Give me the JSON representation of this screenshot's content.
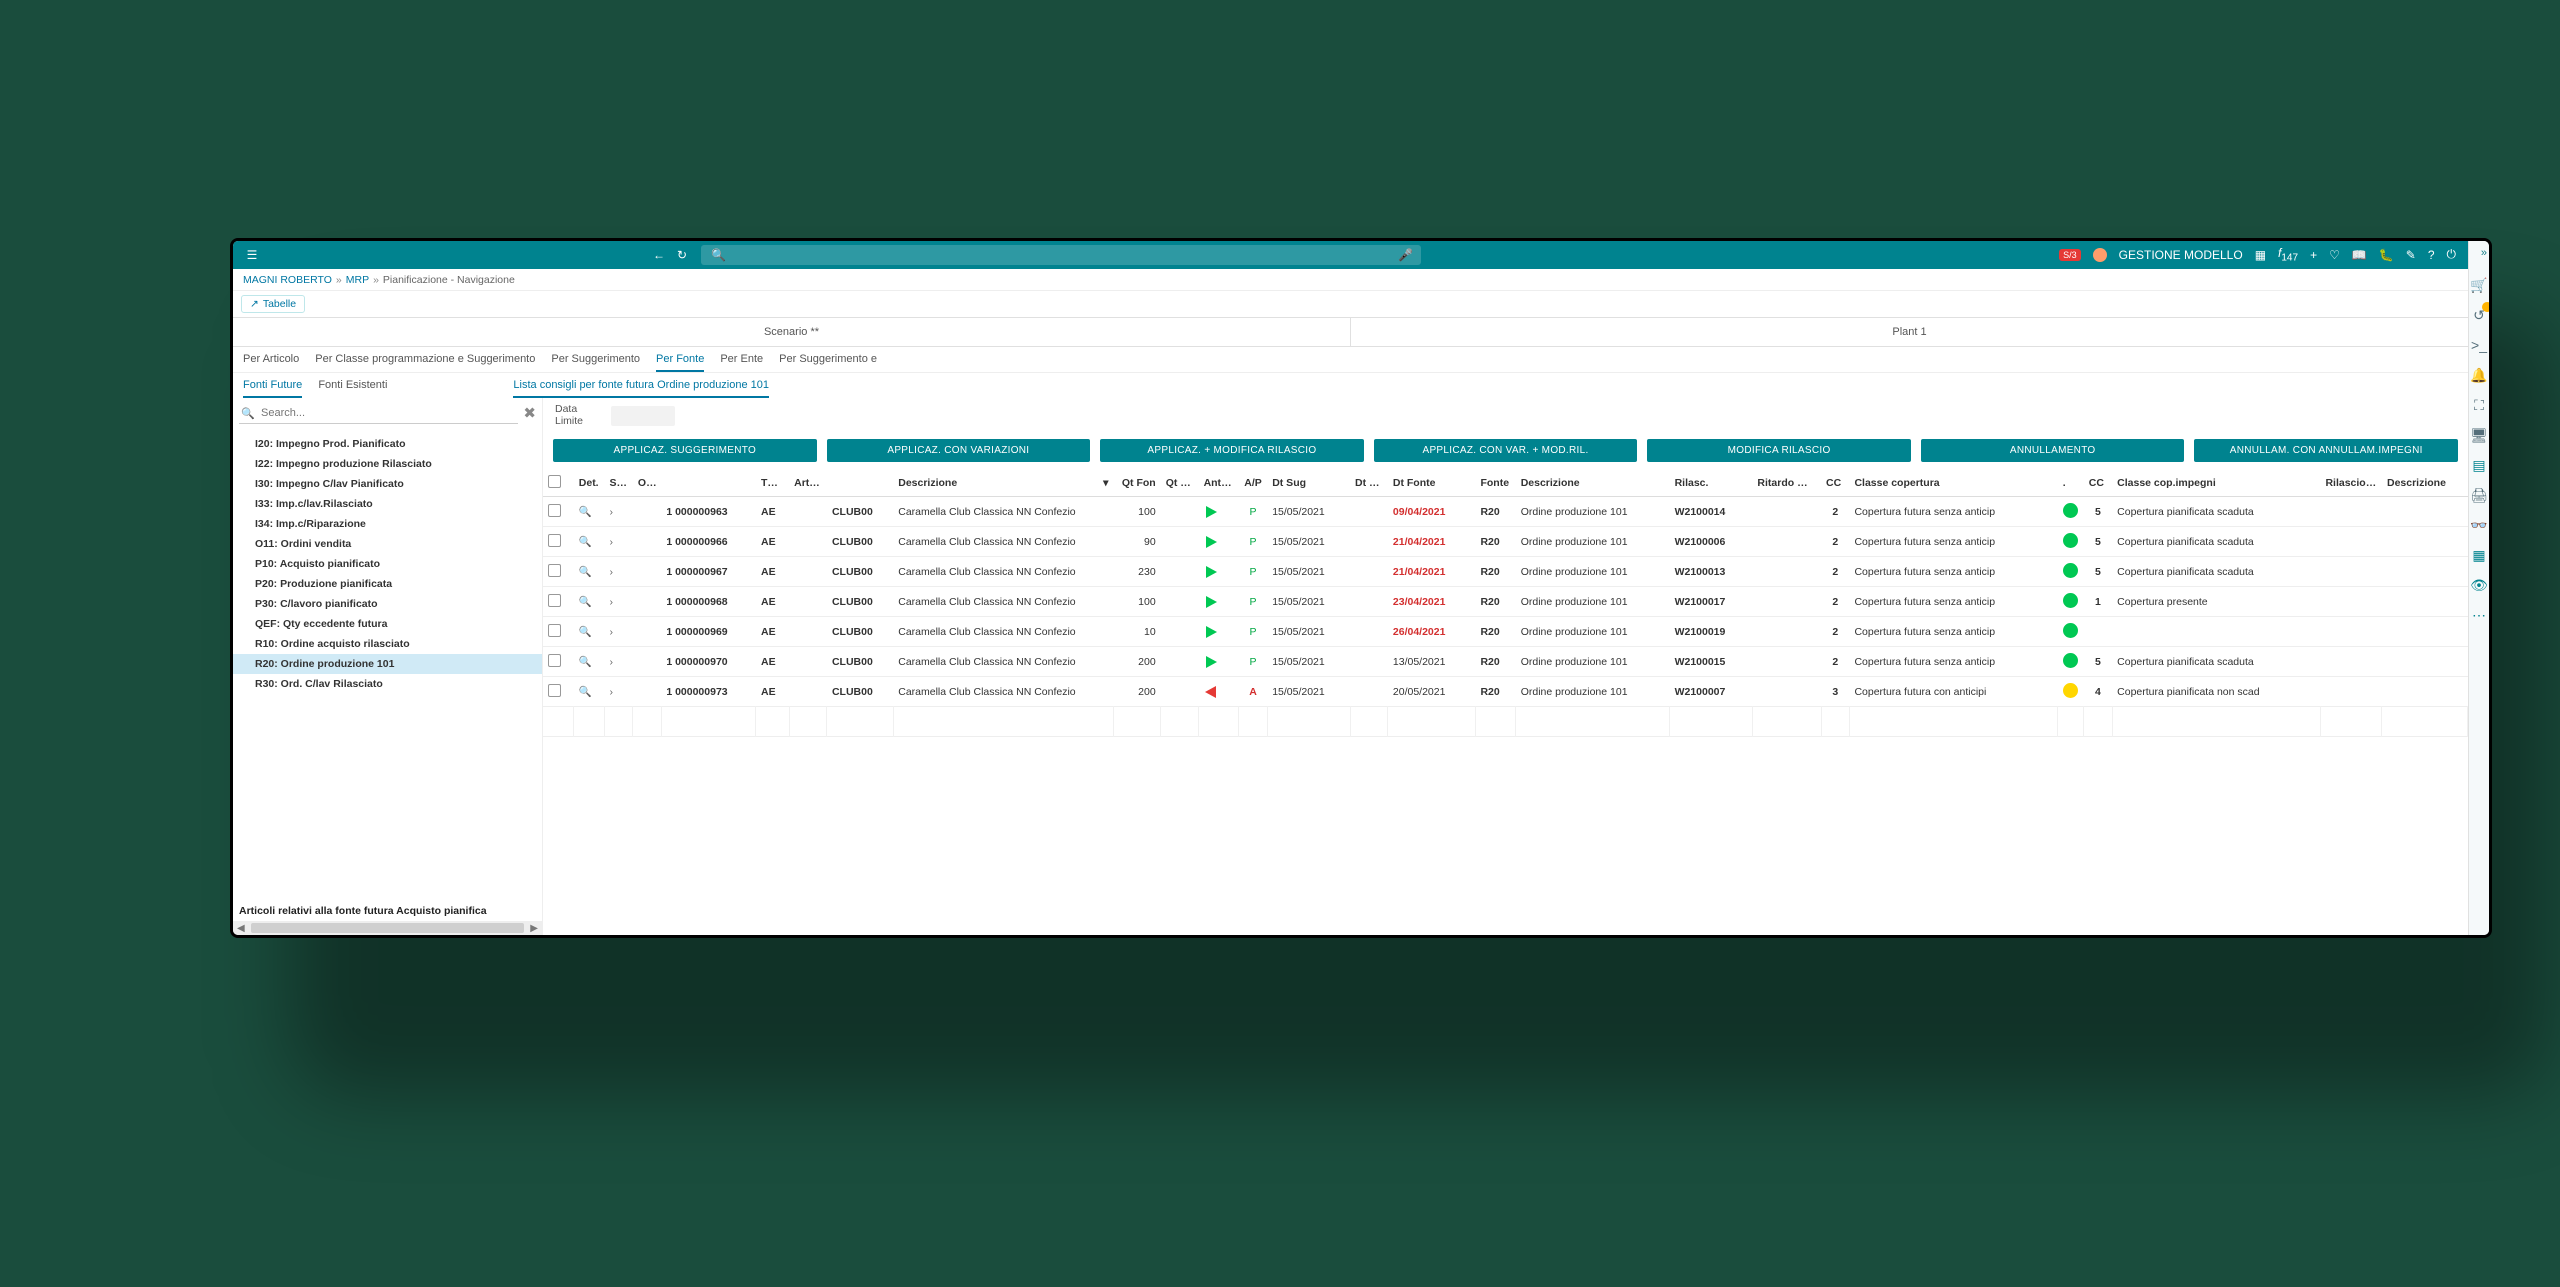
{
  "topbar": {
    "search_placeholder": "",
    "brand_badge": "S/3",
    "user_label": "GESTIONE MODELLO",
    "fx_label": "f",
    "fx_count": "147"
  },
  "breadcrumb": [
    "MAGNI ROBERTO",
    "MRP",
    "Pianificazione - Navigazione"
  ],
  "chip_label": "Tabelle",
  "header": {
    "scenario": "Scenario **",
    "plant": "Plant 1"
  },
  "tabs": [
    "Per Articolo",
    "Per Classe programmazione e Suggerimento",
    "Per Suggerimento",
    "Per Fonte",
    "Per Ente",
    "Per Suggerimento e"
  ],
  "subtabs": [
    "Fonti Future",
    "Fonti Esistenti"
  ],
  "subtabs_detail": "Lista consigli per fonte futura Ordine produzione 101",
  "sidebar": {
    "search_placeholder": "Search...",
    "items": [
      "I20: Impegno Prod. Pianificato",
      "I22: Impegno produzione Rilasciato",
      "I30: Impegno C/lav Pianificato",
      "I33: Imp.c/lav.Rilasciato",
      "I34: Imp.c/Riparazione",
      "O11: Ordini vendita",
      "P10: Acquisto pianificato",
      "P20: Produzione pianificata",
      "P30: C/lavoro pianificato",
      "QEF: Qty eccedente futura",
      "R10: Ordine acquisto rilasciato",
      "R20: Ordine produzione 101",
      "R30: Ord. C/lav Rilasciato"
    ],
    "footer_msg": "Articoli relativi alla fonte futura Acquisto pianifica"
  },
  "content": {
    "data_limite_label": "Data Limite",
    "buttons": [
      "APPLICAZ. SUGGERIMENTO",
      "APPLICAZ. CON VARIAZIONI",
      "APPLICAZ. + MODIFICA RILASCIO",
      "APPLICAZ. CON VAR. + MOD.RIL.",
      "MODIFICA RILASCIO",
      "ANNULLAMENTO",
      "ANNULLAM. CON ANNULLAM.IMPEGNI"
    ]
  },
  "right_rail": {
    "badge": ""
  },
  "table": {
    "headers": {
      "det": "Det.",
      "sug": "Sug.",
      "origine": "Origine",
      "tp_sug": "Tp Sug",
      "articolo": "Articolo",
      "descrizione": "Descrizione",
      "qt_fon": "Qt Fon",
      "qt_sug": "Qt Sug",
      "ant_rit": "Ant. Rit.",
      "ap": "A/P",
      "dt_sug": "Dt Sug",
      "dt_fp": "Dt F.p.",
      "dt_fonte": "Dt Fonte",
      "fonte": "Fonte",
      "descrizione2": "Descrizione",
      "rilasc": "Rilasc.",
      "rit_min": "Ritardo Minimo presunto Lordo",
      "cc": "CC",
      "classe_cop": "Classe copertura",
      "dot": ".",
      "cc2": "CC",
      "classe_cop_imp": "Classe cop.impegni",
      "ril_selfie": "Rilascio Selfie",
      "descrizione3": "Descrizione"
    },
    "rows": [
      {
        "origine": "1 000000963",
        "ae": "AE",
        "art": "CLUB00",
        "desc": "Caramella Club Classica NN Confezio",
        "qt_fon": "100",
        "ap": "P",
        "dt_sug": "15/05/2021",
        "dt_fonte": "09/04/2021",
        "dt_fonte_red": true,
        "fonte": "R20",
        "desc2": "Ordine produzione 101",
        "rilasc": "W2100014",
        "cc": "2",
        "classe_cop": "Copertura futura senza anticip",
        "status": "green",
        "cc2": "5",
        "classe_imp": "Copertura pianificata scaduta"
      },
      {
        "origine": "1 000000966",
        "ae": "AE",
        "art": "CLUB00",
        "desc": "Caramella Club Classica NN Confezio",
        "qt_fon": "90",
        "ap": "P",
        "dt_sug": "15/05/2021",
        "dt_fonte": "21/04/2021",
        "dt_fonte_red": true,
        "fonte": "R20",
        "desc2": "Ordine produzione 101",
        "rilasc": "W2100006",
        "cc": "2",
        "classe_cop": "Copertura futura senza anticip",
        "status": "green",
        "cc2": "5",
        "classe_imp": "Copertura pianificata scaduta"
      },
      {
        "origine": "1 000000967",
        "ae": "AE",
        "art": "CLUB00",
        "desc": "Caramella Club Classica NN Confezio",
        "qt_fon": "230",
        "ap": "P",
        "dt_sug": "15/05/2021",
        "dt_fonte": "21/04/2021",
        "dt_fonte_red": true,
        "fonte": "R20",
        "desc2": "Ordine produzione 101",
        "rilasc": "W2100013",
        "cc": "2",
        "classe_cop": "Copertura futura senza anticip",
        "status": "green",
        "cc2": "5",
        "classe_imp": "Copertura pianificata scaduta"
      },
      {
        "origine": "1 000000968",
        "ae": "AE",
        "art": "CLUB00",
        "desc": "Caramella Club Classica NN Confezio",
        "qt_fon": "100",
        "ap": "P",
        "dt_sug": "15/05/2021",
        "dt_fonte": "23/04/2021",
        "dt_fonte_red": true,
        "fonte": "R20",
        "desc2": "Ordine produzione 101",
        "rilasc": "W2100017",
        "cc": "2",
        "classe_cop": "Copertura futura senza anticip",
        "status": "green",
        "cc2": "1",
        "classe_imp": "Copertura presente"
      },
      {
        "origine": "1 000000969",
        "ae": "AE",
        "art": "CLUB00",
        "desc": "Caramella Club Classica NN Confezio",
        "qt_fon": "10",
        "ap": "P",
        "dt_sug": "15/05/2021",
        "dt_fonte": "26/04/2021",
        "dt_fonte_red": true,
        "fonte": "R20",
        "desc2": "Ordine produzione 101",
        "rilasc": "W2100019",
        "cc": "2",
        "classe_cop": "Copertura futura senza anticip",
        "status": "green",
        "cc2": "",
        "classe_imp": ""
      },
      {
        "origine": "1 000000970",
        "ae": "AE",
        "art": "CLUB00",
        "desc": "Caramella Club Classica NN Confezio",
        "qt_fon": "200",
        "ap": "P",
        "dt_sug": "15/05/2021",
        "dt_fonte": "13/05/2021",
        "dt_fonte_red": false,
        "fonte": "R20",
        "desc2": "Ordine produzione 101",
        "rilasc": "W2100015",
        "cc": "2",
        "classe_cop": "Copertura futura senza anticip",
        "status": "green",
        "cc2": "5",
        "classe_imp": "Copertura pianificata scaduta"
      },
      {
        "origine": "1 000000973",
        "ae": "AE",
        "art": "CLUB00",
        "desc": "Caramella Club Classica NN Confezio",
        "qt_fon": "200",
        "ap": "A",
        "ap_red": true,
        "dt_sug": "15/05/2021",
        "dt_fonte": "20/05/2021",
        "dt_fonte_red": false,
        "fonte": "R20",
        "desc2": "Ordine produzione 101",
        "rilasc": "W2100007",
        "cc": "3",
        "classe_cop": "Copertura futura con anticipi",
        "status": "yellow",
        "cc2": "4",
        "classe_imp": "Copertura pianificata non scad"
      }
    ]
  }
}
